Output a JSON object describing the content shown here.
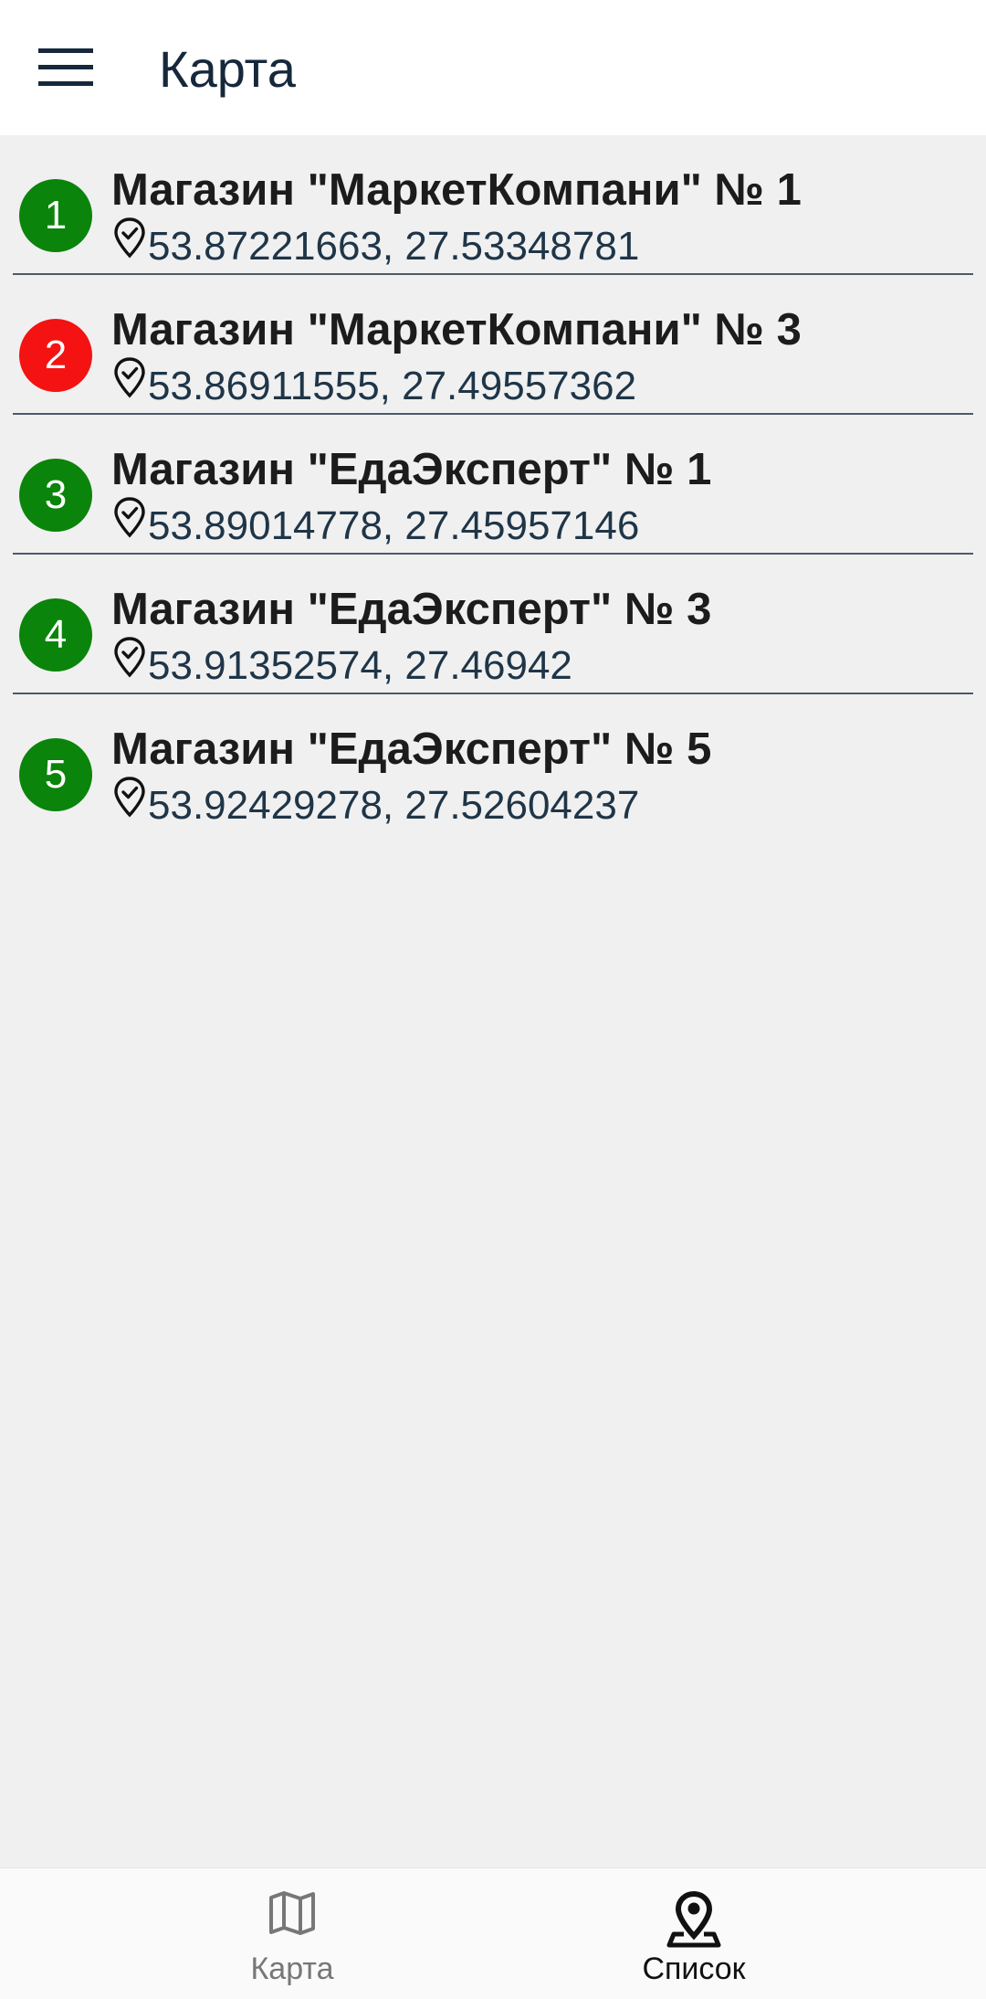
{
  "header": {
    "title": "Карта",
    "menu_icon": "hamburger-menu-icon"
  },
  "colors": {
    "status_ok": "#0a840a",
    "status_alert": "#f41212",
    "header_text": "#16283b",
    "divider": "#4b5a69"
  },
  "stores": [
    {
      "number": "1",
      "name": "Магазин \"МаркетКомпани\" № 1",
      "coords": "53.87221663, 27.53348781",
      "status": "ok"
    },
    {
      "number": "2",
      "name": "Магазин \"МаркетКомпани\" № 3",
      "coords": "53.86911555, 27.49557362",
      "status": "alert"
    },
    {
      "number": "3",
      "name": "Магазин \"ЕдаЭксперт\" № 1",
      "coords": "53.89014778, 27.45957146",
      "status": "ok"
    },
    {
      "number": "4",
      "name": "Магазин \"ЕдаЭксперт\" № 3",
      "coords": "53.91352574, 27.46942",
      "status": "ok"
    },
    {
      "number": "5",
      "name": "Магазин \"ЕдаЭксперт\" № 5",
      "coords": "53.92429278, 27.52604237",
      "status": "ok"
    }
  ],
  "bottom_nav": {
    "map_tab": {
      "label": "Карта",
      "icon": "map-icon",
      "active": false
    },
    "list_tab": {
      "label": "Список",
      "icon": "location-pin-icon",
      "active": true
    }
  }
}
